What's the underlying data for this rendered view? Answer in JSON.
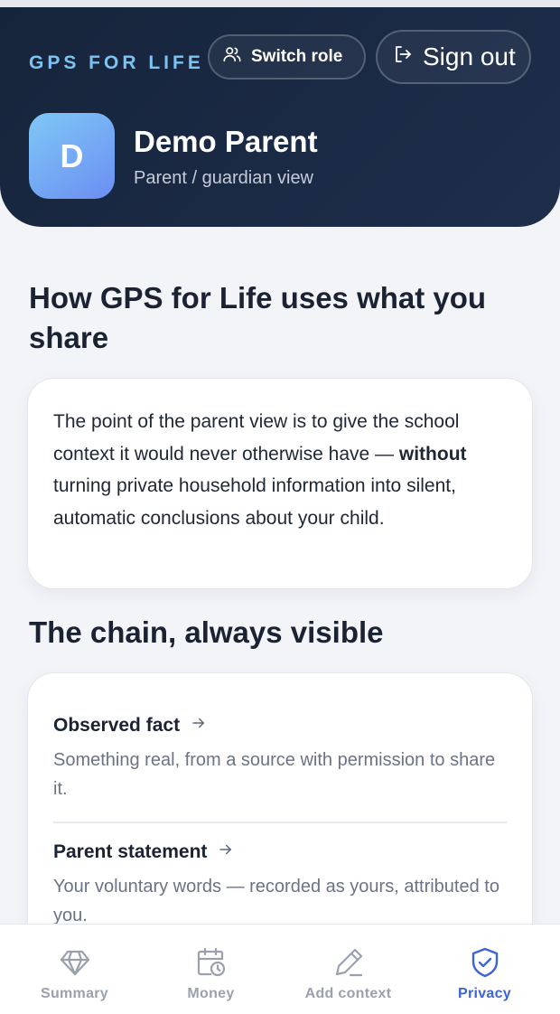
{
  "header": {
    "brand": "GPS FOR LIFE",
    "switch_role_label": "Switch role",
    "sign_out_label": "Sign out",
    "avatar_initial": "D",
    "user_name": "Demo Parent",
    "user_role": "Parent / guardian view"
  },
  "main": {
    "section_title": "How GPS for Life uses what you share",
    "intro": {
      "before": "The point of the parent view is to give the school context it would never otherwise have — ",
      "bold": "without",
      "after": " turning private household information into silent, automatic conclusions about your child."
    },
    "chain_title": "The chain, always visible",
    "chain": [
      {
        "title": "Observed fact",
        "desc": "Something real, from a source with permission to share it."
      },
      {
        "title": "Parent statement",
        "desc": "Your voluntary words — recorded as yours, attributed to you."
      }
    ]
  },
  "tabs": [
    {
      "label": "Summary",
      "icon": "diamond-icon"
    },
    {
      "label": "Money",
      "icon": "calendar-clock-icon"
    },
    {
      "label": "Add context",
      "icon": "pencil-icon"
    },
    {
      "label": "Privacy",
      "icon": "shield-check-icon",
      "active": true
    }
  ],
  "colors": {
    "header_bg": "#16243b",
    "brand": "#7dc3f2",
    "accent": "#3d63d8",
    "avatar_from": "#7fc8f6",
    "avatar_to": "#6b8ef2"
  }
}
